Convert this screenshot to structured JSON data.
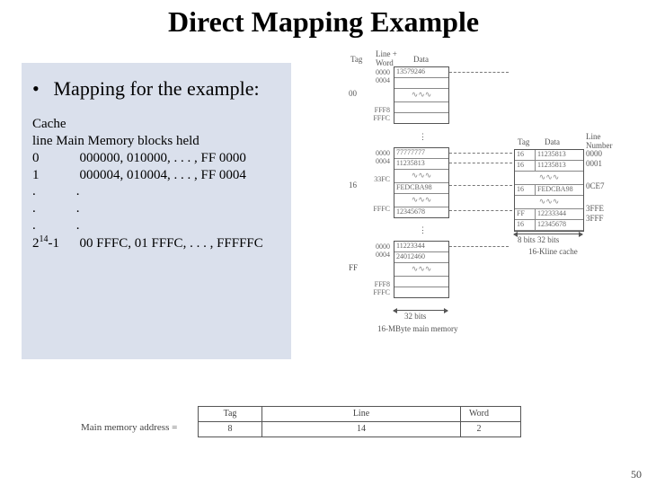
{
  "title": "Direct Mapping Example",
  "bullet": "Mapping for the example:",
  "left_table": {
    "header1": "Cache",
    "header2": "line Main Memory blocks held",
    "rows": [
      {
        "line": "0",
        "blocks": "000000, 010000, . . . , FF 0000"
      },
      {
        "line": "1",
        "blocks": "000004, 010004, . . . , FF 0004"
      },
      {
        "line": ".",
        "blocks": "            ."
      },
      {
        "line": ".",
        "blocks": "            ."
      },
      {
        "line": ".",
        "blocks": "            ."
      }
    ],
    "last_line_prefix": "2",
    "last_line_exp": "14",
    "last_line_suffix": "-1",
    "last_blocks": "00 FFFC, 01 FFFC, . . . , FFFFFC"
  },
  "diagram": {
    "top_labels": {
      "tag": "Tag",
      "linew": "Line +\nWord",
      "data": "Data"
    },
    "mem_blocks": [
      {
        "addr_top": "0000",
        "addr_next": "0004",
        "data_top": "13579246",
        "addr_bot1": "FFF8",
        "addr_bot2": "FFFC"
      },
      {
        "addr_top": "0000",
        "addr_next": "0004",
        "data_top": "77777777",
        "data_next": "11235813",
        "addr_bot1": "FFFC",
        "data_bot": "12345678"
      },
      {
        "addr_top": "0000",
        "addr_next": "0004",
        "data_top": "11223344",
        "data_next": "24012460",
        "addr_bot1": "FFF8",
        "addr_bot2": "FFFC"
      }
    ],
    "left_tags": [
      "00",
      "16",
      "FF"
    ],
    "cache": {
      "col1": "Tag",
      "col2": "Data",
      "col3": "Line\nNumber",
      "rows": [
        {
          "tag": "16",
          "data": "11235813",
          "ln": "0000"
        },
        {
          "tag": "16",
          "data": "11235813",
          "ln": "0001"
        },
        {
          "tag": "FF",
          "data": "12233344",
          "ln": "3FFE"
        },
        {
          "tag": "16",
          "data": "12345678",
          "ln": "3FFF"
        }
      ],
      "mid_tag": "16",
      "mid_data": "FEDCBA98",
      "mid_ln": "0CE7"
    },
    "cache_note": "8 bits   32 bits",
    "cache_caption": "16-Kline cache",
    "mem_width": "32 bits",
    "mem_caption": "16-MByte main memory",
    "addr33FC": "33FC",
    "dataFEDCBA98": "FEDCBA98"
  },
  "addr_decomp": {
    "label": "Main memory address =",
    "fields": [
      "Tag",
      "Line",
      "Word"
    ],
    "widths": [
      "8",
      "14",
      "2"
    ]
  },
  "page_number": "50"
}
